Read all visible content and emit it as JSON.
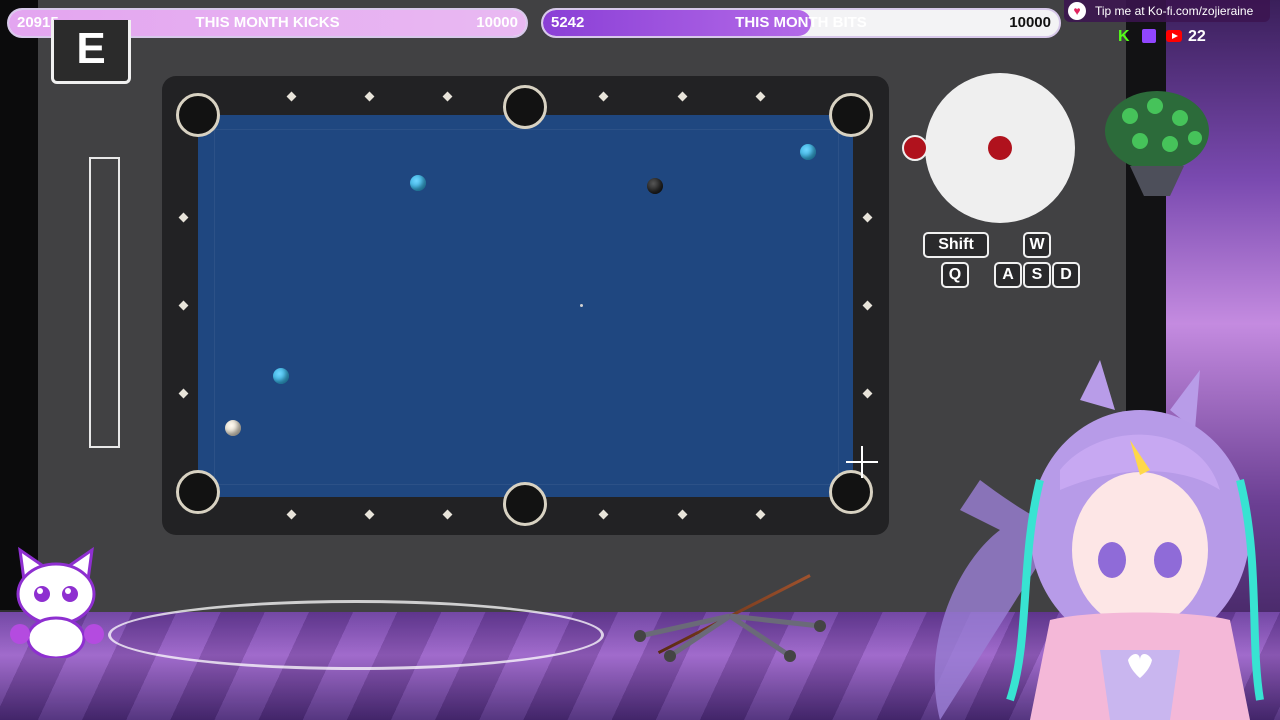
{
  "stream_overlay": {
    "kicks_goal": {
      "current": "20915",
      "label": "THIS MONTH KICKS",
      "goal": "10000",
      "progress": 1.0
    },
    "bits_goal": {
      "current": "5242",
      "label": "THIS MONTH BITS",
      "goal": "10000",
      "progress": 0.52
    },
    "kofi": {
      "icon": "heart-icon",
      "text": "Tip me at Ko-fi.com/zojieraine"
    },
    "viewers": {
      "kick_letter": "K",
      "icons": [
        "kick-icon",
        "twitch-icon",
        "youtube-icon"
      ],
      "count": "22"
    }
  },
  "game": {
    "interact_key": "E",
    "power_meter_level": 0,
    "table": {
      "cloth_color": "#1f4780",
      "balls": [
        {
          "kind": "blue"
        },
        {
          "kind": "black"
        },
        {
          "kind": "blue"
        },
        {
          "kind": "blue"
        },
        {
          "kind": "white"
        }
      ]
    },
    "spin_control": {
      "color": "#b0121d"
    },
    "controls": {
      "shift": "Shift",
      "w": "W",
      "q": "Q",
      "a": "A",
      "s": "S",
      "d": "D"
    }
  },
  "colors": {
    "accent_purple": "#8a3fd6",
    "pink": "#e3a5f0",
    "table_blue": "#1f4780",
    "spin_red": "#b0121d"
  }
}
